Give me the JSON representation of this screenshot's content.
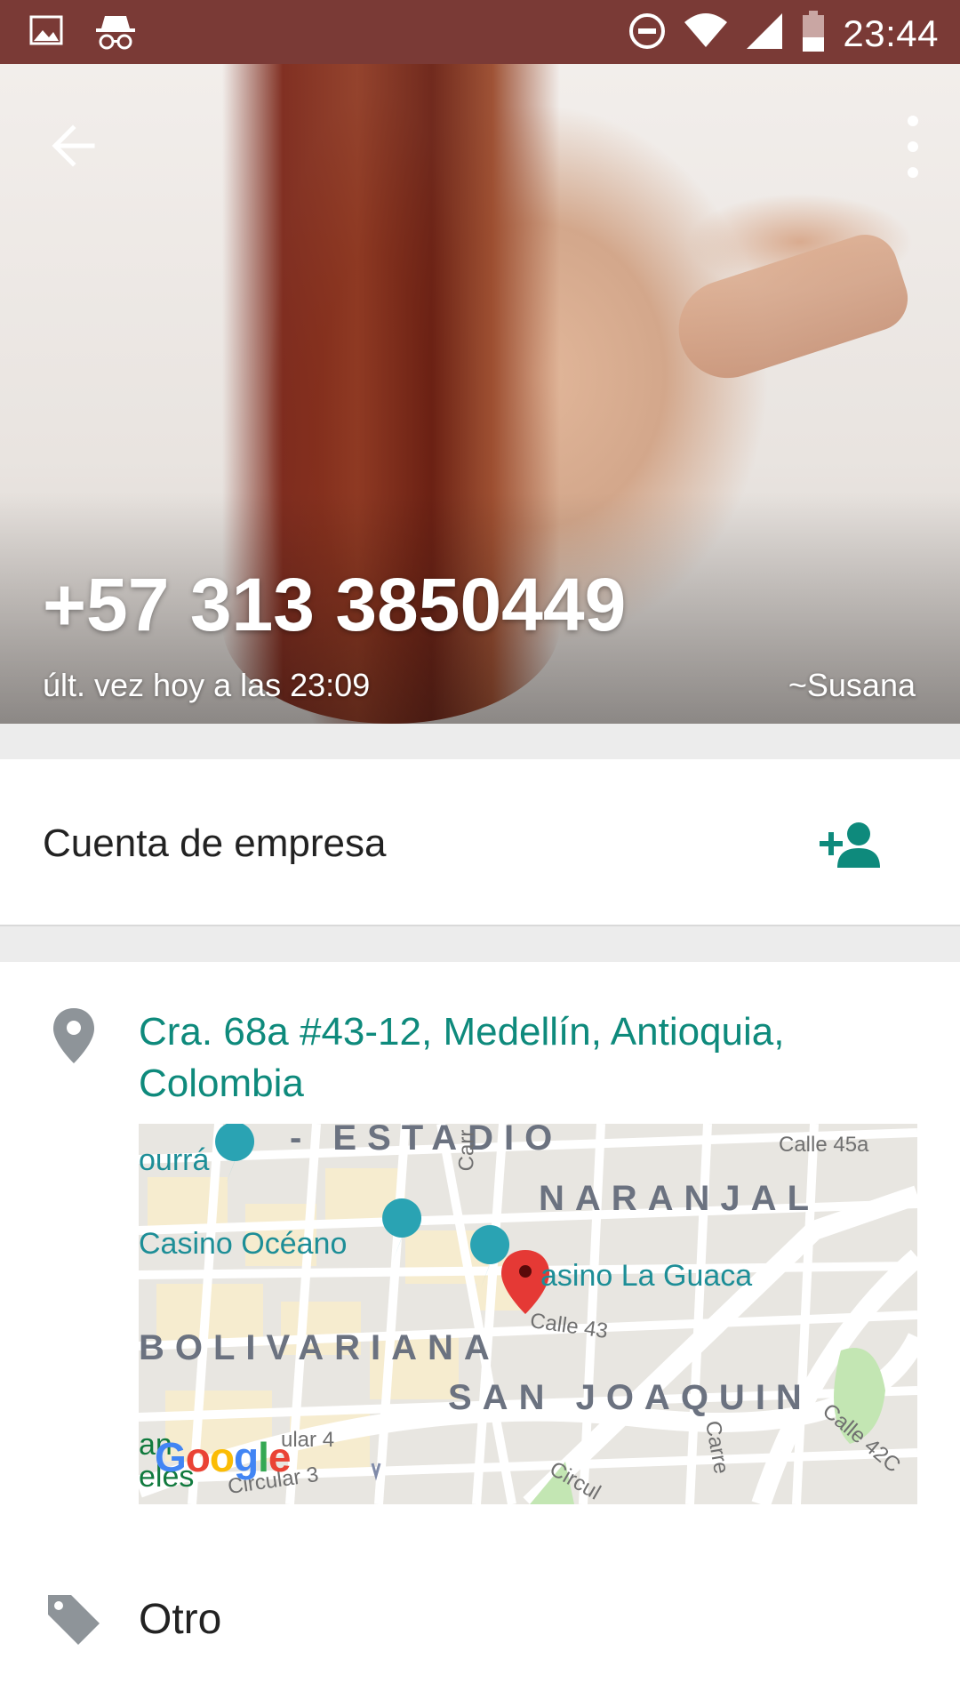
{
  "status_bar": {
    "time": "23:44",
    "icons": [
      "gallery-icon",
      "incognito-icon",
      "do-not-disturb-icon",
      "wifi-icon",
      "signal-icon",
      "battery-icon"
    ]
  },
  "header": {
    "phone": "+57 313 3850449",
    "last_seen": "últ. vez hoy a las 23:09",
    "alias": "~Susana"
  },
  "business": {
    "label": "Cuenta de empresa"
  },
  "info": {
    "address": "Cra. 68a #43-12, Medellín, Antioquia, Colombia",
    "category": "Otro"
  },
  "map": {
    "labels": {
      "estadio": "- ESTADIO",
      "naranjal": "NARANJAL",
      "bolivariana": "BOLIVARIANA",
      "san_joaquin": "SAN JOAQUIN",
      "casino_oceano": "Casino Océano",
      "casino_guaca": "asino La Guaca",
      "poi_partial": "ourrá",
      "calle_45a": "Calle 45a",
      "calle_43": "Calle 43",
      "calle_42c": "Calle 42C",
      "circular_4": "ular 4",
      "circular_3": "Circular 3",
      "circular": "Circul",
      "carrera": "Carre",
      "carr": "Carr",
      "angeles_1": "an",
      "angeles_2": "eles",
      "google": "Google"
    }
  },
  "colors": {
    "status_bar": "#7a3a36",
    "accent": "#0e8a7c",
    "icon_gray": "#8e9499",
    "marker": "#e53935"
  }
}
